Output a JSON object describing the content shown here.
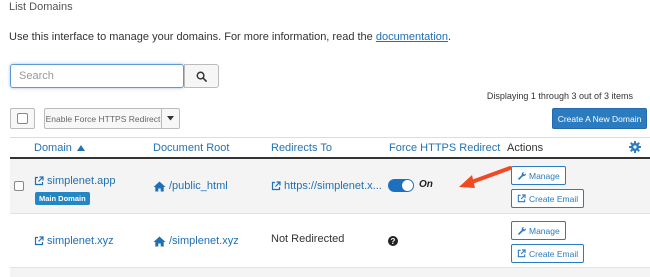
{
  "breadcrumb": "List Domains",
  "intro": {
    "text": "Use this interface to manage your domains. For more information, read the ",
    "link": "documentation",
    "suffix": "."
  },
  "search": {
    "placeholder": "Search",
    "value": "",
    "button_icon": "search-icon"
  },
  "displaying": "Displaying 1 through 3 out of 3 items",
  "toolbar": {
    "force_https_label": "Enable Force HTTPS Redirect",
    "create_domain_label": "Create A New Domain"
  },
  "table": {
    "headers": {
      "domain": "Domain",
      "document_root": "Document Root",
      "redirects_to": "Redirects To",
      "force_https": "Force HTTPS Redirect",
      "actions": "Actions"
    },
    "rows": [
      {
        "domain": "simplenet.app",
        "badge": "Main Domain",
        "document_root": "/public_html",
        "redirects_to": "https://simplenet.x...",
        "force_https_state": "On",
        "manage_label": "Manage",
        "email_label": "Create Email"
      },
      {
        "domain": "simplenet.xyz",
        "document_root": "/simplenet.xyz",
        "redirects_to": "Not Redirected",
        "force_https_state": "?",
        "manage_label": "Manage",
        "email_label": "Create Email"
      }
    ]
  },
  "colors": {
    "link": "#1f6fb5",
    "primary_button": "#2b7bc1",
    "badge": "#2387c6",
    "toggle_on": "#1d6fc0",
    "annotation_arrow": "#f04a23"
  },
  "icons": [
    "search-icon",
    "caret-down-icon",
    "sort-up-icon",
    "gear-icon",
    "external-link-icon",
    "home-icon",
    "wrench-icon",
    "envelope-icon",
    "question-circle-icon",
    "annotation-arrow-icon"
  ]
}
